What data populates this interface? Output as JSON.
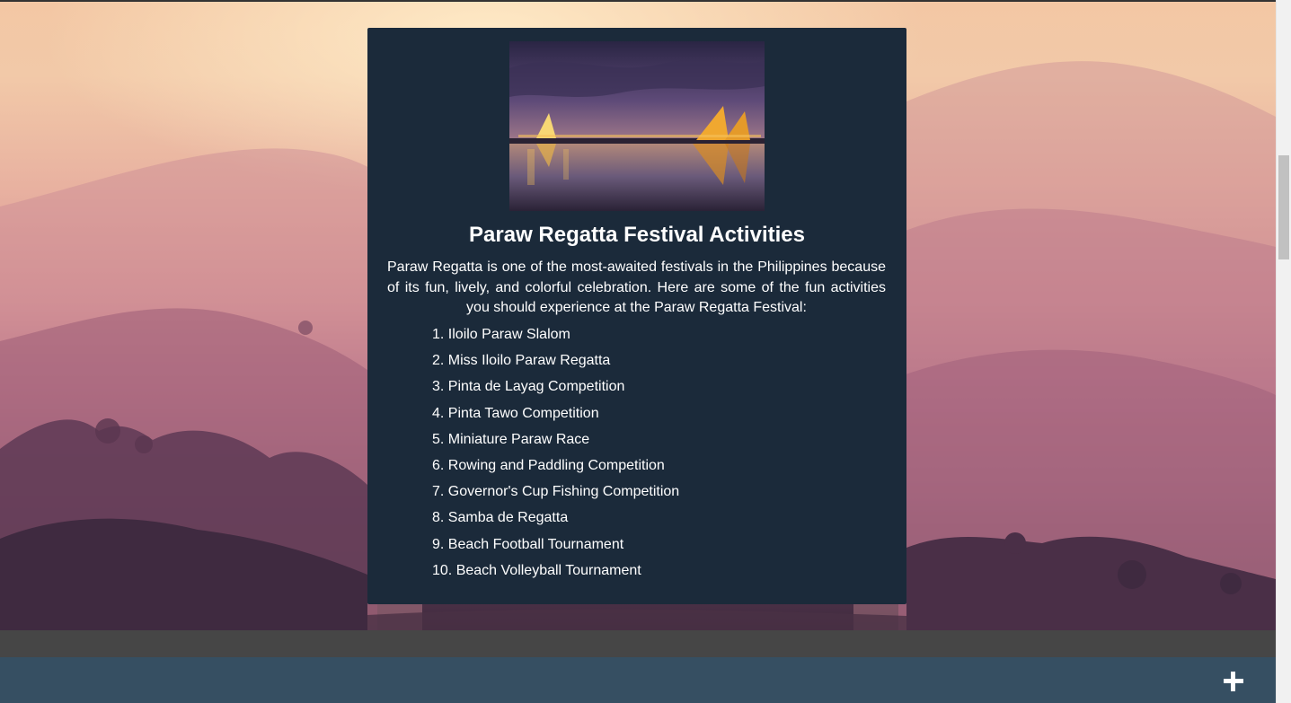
{
  "card": {
    "image_alt": "Paraw sailboats at sunset reflected on water",
    "title": "Paraw Regatta Festival Activities",
    "intro": "Paraw Regatta is one of the most-awaited festivals in the Philippines because of its fun, lively, and colorful celebration. Here are some of the fun activities you should experience at the Paraw Regatta Festival:",
    "activities": [
      "1. Iloilo Paraw Slalom",
      "2. Miss Iloilo Paraw Regatta",
      "3. Pinta de Layag Competition",
      "4. Pinta Tawo Competition",
      "5. Miniature Paraw Race",
      "6. Rowing and Paddling Competition",
      "7. Governor's Cup Fishing Competition",
      "8. Samba de Regatta",
      "9. Beach Football Tournament",
      "10. Beach Volleyball Tournament"
    ]
  },
  "footer": {
    "expand_icon": "plus-icon"
  },
  "colors": {
    "card_bg": "#1b2a3a",
    "footer_dark": "#464646",
    "footer_teal": "#364f62",
    "text": "#ffffff"
  }
}
